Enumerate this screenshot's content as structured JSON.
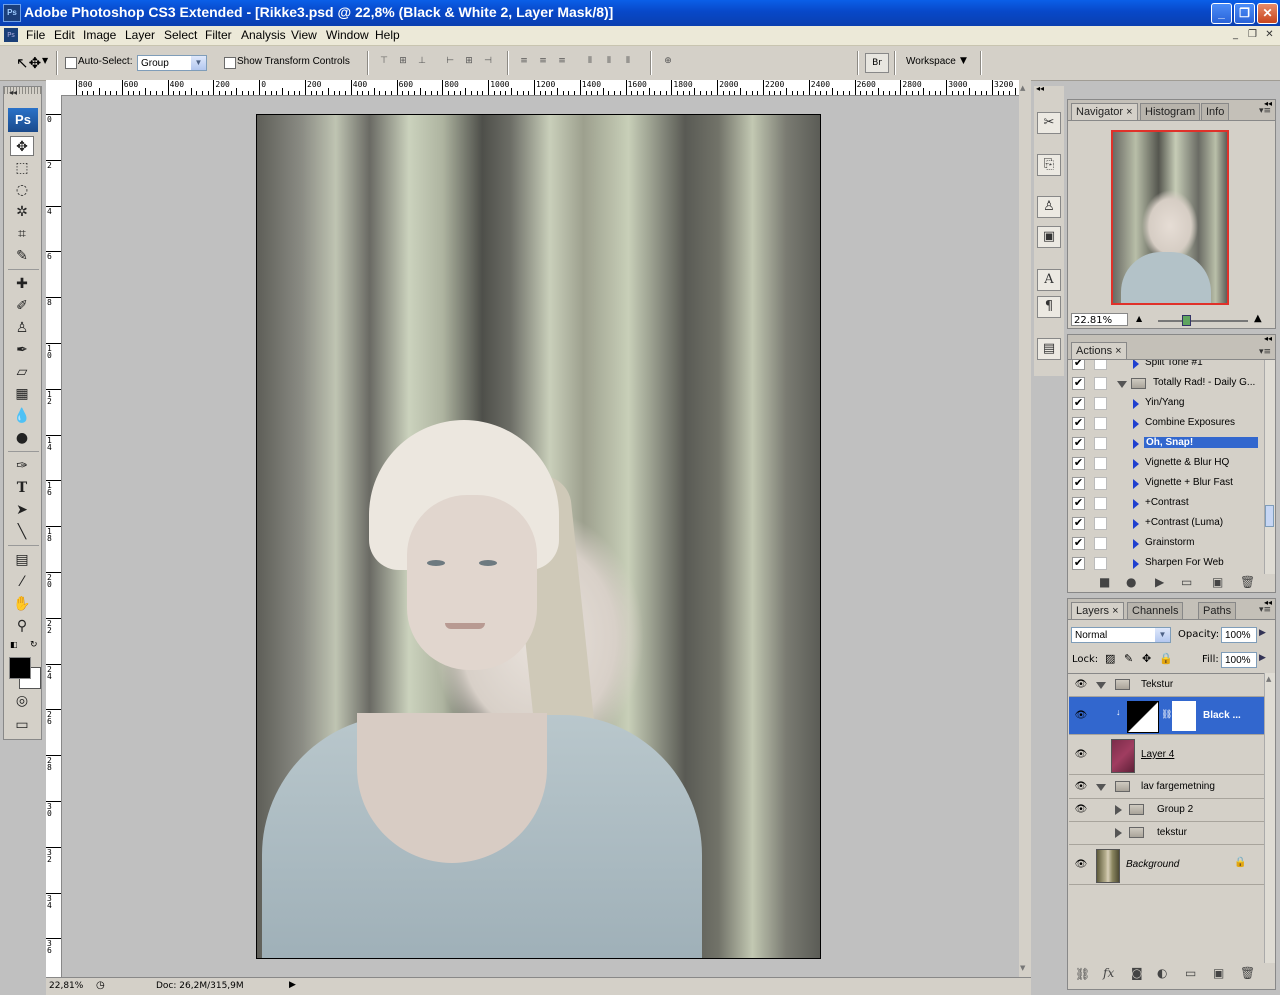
{
  "window": {
    "title": "Adobe Photoshop CS3 Extended - [Rikke3.psd @ 22,8% (Black & White 2, Layer Mask/8)]",
    "app_icon": "Ps"
  },
  "menu": [
    "File",
    "Edit",
    "Image",
    "Layer",
    "Select",
    "Filter",
    "Analysis",
    "View",
    "Window",
    "Help"
  ],
  "options": {
    "auto_select_label": "Auto-Select:",
    "auto_select_value": "Group",
    "show_transform_label": "Show Transform Controls",
    "workspace_label": "Workspace"
  },
  "ruler_h": [
    "800",
    "600",
    "400",
    "200",
    "0",
    "200",
    "400",
    "600",
    "800",
    "1000",
    "1200",
    "1400",
    "1600",
    "1800",
    "2000",
    "2200",
    "2400",
    "2600",
    "2800",
    "3000",
    "3200"
  ],
  "ruler_v": [
    "0",
    "2",
    "4",
    "6",
    "8",
    "1 0",
    "1 2",
    "1 4",
    "1 6",
    "1 8",
    "2 0",
    "2 2",
    "2 4",
    "2 6",
    "2 8",
    "3 0",
    "3 2",
    "3 4",
    "3 6"
  ],
  "status": {
    "zoom": "22,81%",
    "doc": "Doc: 26,2M/315,9M"
  },
  "navigator": {
    "tabs": [
      "Navigator",
      "Histogram",
      "Info"
    ],
    "zoom": "22.81%"
  },
  "actions": {
    "tab": "Actions",
    "items": [
      {
        "label": "Split Tone #1",
        "checked": true,
        "type": "action"
      },
      {
        "label": "Totally Rad! - Daily G...",
        "checked": true,
        "type": "set"
      },
      {
        "label": "Yin/Yang",
        "checked": true,
        "type": "action"
      },
      {
        "label": "Combine Exposures",
        "checked": true,
        "type": "action"
      },
      {
        "label": "Oh, Snap!",
        "checked": true,
        "type": "action",
        "highlight": true
      },
      {
        "label": "Vignette & Blur HQ",
        "checked": true,
        "type": "action"
      },
      {
        "label": "Vignette + Blur Fast",
        "checked": true,
        "type": "action"
      },
      {
        "label": "+Contrast",
        "checked": true,
        "type": "action"
      },
      {
        "label": "+Contrast (Luma)",
        "checked": true,
        "type": "action"
      },
      {
        "label": "Grainstorm",
        "checked": true,
        "type": "action"
      },
      {
        "label": "Sharpen For Web",
        "checked": true,
        "type": "action"
      }
    ]
  },
  "layers": {
    "tabs": [
      "Layers",
      "Channels",
      "Paths"
    ],
    "blend": "Normal",
    "opacity_label": "Opacity:",
    "opacity": "100%",
    "lock_label": "Lock:",
    "fill_label": "Fill:",
    "fill": "100%",
    "rows": [
      {
        "name": "Tekstur",
        "kind": "group",
        "open": true,
        "visible": true
      },
      {
        "name": "Black ...",
        "kind": "adjustment",
        "visible": true,
        "selected": true
      },
      {
        "name": "Layer 4",
        "kind": "layer",
        "visible": true
      },
      {
        "name": "lav fargemetning",
        "kind": "group",
        "open": true,
        "visible": true
      },
      {
        "name": "Group 2",
        "kind": "group",
        "open": false,
        "visible": true
      },
      {
        "name": "tekstur",
        "kind": "group",
        "open": false,
        "visible": false
      },
      {
        "name": "Background",
        "kind": "background",
        "visible": true,
        "locked": true
      }
    ]
  }
}
